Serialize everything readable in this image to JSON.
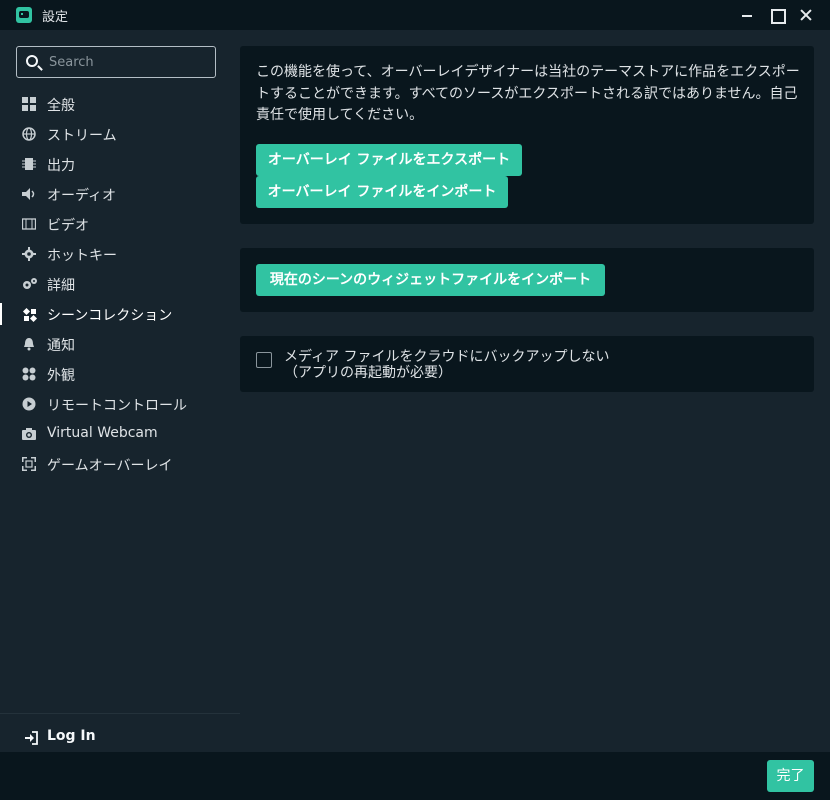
{
  "window": {
    "title": "設定",
    "app_icon": "streamlabs-logo-icon",
    "controls": [
      "minimize-icon",
      "maximize-icon",
      "close-icon"
    ]
  },
  "sidebar": {
    "search_placeholder": "Search",
    "items": [
      {
        "label": "全般",
        "icon": "grid-icon",
        "active": false
      },
      {
        "label": "ストリーム",
        "icon": "globe-icon",
        "active": false
      },
      {
        "label": "出力",
        "icon": "chip-icon",
        "active": false
      },
      {
        "label": "オーディオ",
        "icon": "speaker-icon",
        "active": false
      },
      {
        "label": "ビデオ",
        "icon": "film-icon",
        "active": false
      },
      {
        "label": "ホットキー",
        "icon": "gear-icon",
        "active": false
      },
      {
        "label": "詳細",
        "icon": "gears-icon",
        "active": false
      },
      {
        "label": "シーンコレクション",
        "icon": "puzzle-icon",
        "active": true
      },
      {
        "label": "通知",
        "icon": "bell-icon",
        "active": false
      },
      {
        "label": "外観",
        "icon": "palette-icon",
        "active": false
      },
      {
        "label": "リモートコントロール",
        "icon": "play-circle-icon",
        "active": false
      },
      {
        "label": "Virtual Webcam",
        "icon": "camera-icon",
        "active": false
      },
      {
        "label": "ゲームオーバーレイ",
        "icon": "expand-icon",
        "active": false
      }
    ],
    "login_label": "Log In"
  },
  "main": {
    "overlay_card": {
      "description": "この機能を使って、オーバーレイデザイナーは当社のテーマストアに作品をエクスポートすることができます。すべてのソースがエクスポートされる訳ではありません。自己責任で使用してください。",
      "export_label": "オーバーレイ ファイルをエクスポート",
      "import_label": "オーバーレイ ファイルをインポート"
    },
    "widget_card": {
      "import_widget_label": "現在のシーンのウィジェットファイルをインポート"
    },
    "backup_card": {
      "checkbox_label_line1": "メディア ファイルをクラウドにバックアップしない",
      "checkbox_label_line2": "（アプリの再起動が必要）",
      "checked": false
    }
  },
  "footer": {
    "done_label": "完了"
  },
  "colors": {
    "accent": "#31c3a2",
    "background": "#17242d",
    "panel": "#09161d"
  }
}
